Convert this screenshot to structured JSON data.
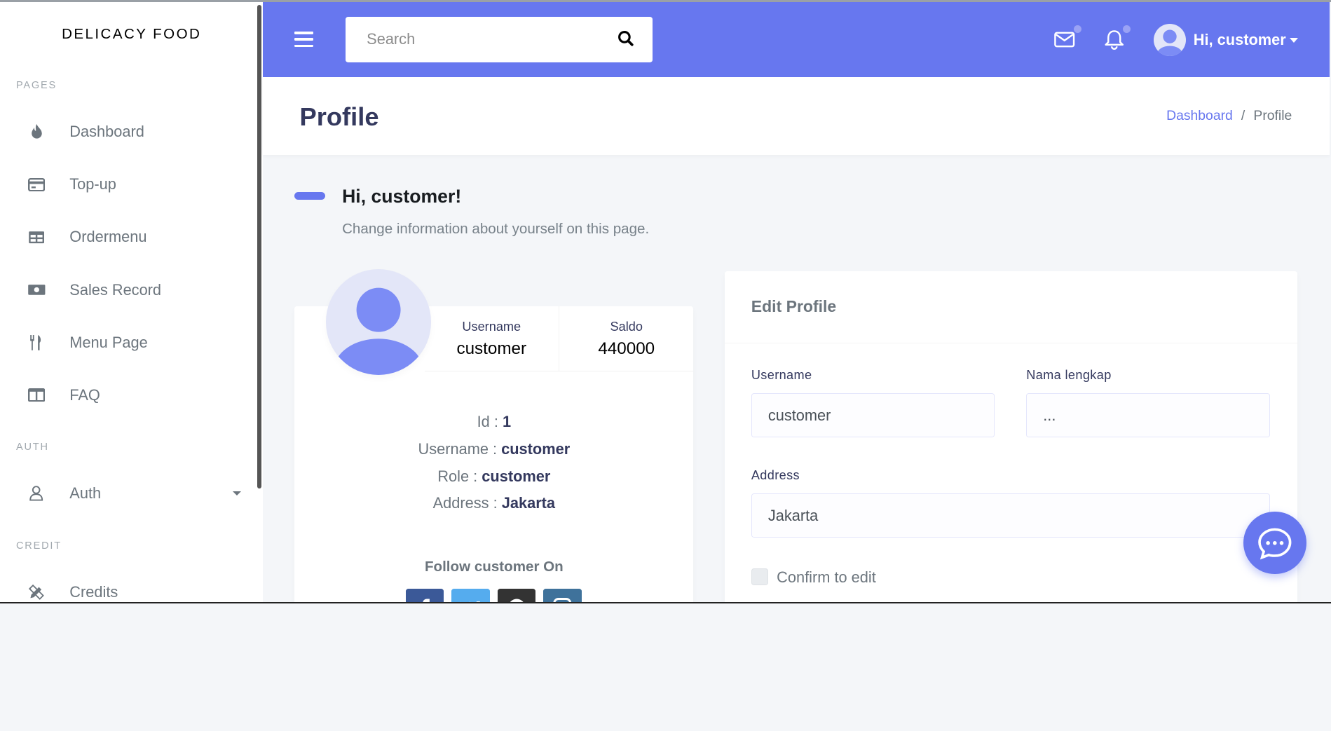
{
  "sidebar": {
    "brand": "DELICACY FOOD",
    "headers": {
      "pages": "PAGES",
      "auth": "AUTH",
      "credit": "CREDIT"
    },
    "items": [
      {
        "label": "Dashboard",
        "icon": "fire-icon"
      },
      {
        "label": "Top-up",
        "icon": "credit-card-icon"
      },
      {
        "label": "Ordermenu",
        "icon": "table-icon"
      },
      {
        "label": "Sales Record",
        "icon": "money-bill-icon"
      },
      {
        "label": "Menu Page",
        "icon": "utensils-icon"
      },
      {
        "label": "FAQ",
        "icon": "columns-icon"
      },
      {
        "label": "Auth",
        "icon": "user-icon"
      },
      {
        "label": "Credits",
        "icon": "pencil-ruler-icon"
      }
    ]
  },
  "navbar": {
    "search_placeholder": "Search",
    "user_greeting": "Hi, customer",
    "accent": "#6777ef"
  },
  "header": {
    "title": "Profile",
    "breadcrumb": [
      "Dashboard",
      "Profile"
    ]
  },
  "section": {
    "title": "Hi, customer!",
    "lead": "Change information about yourself on this page."
  },
  "profile_widget": {
    "items": [
      {
        "label": "Username",
        "value": "customer"
      },
      {
        "label": "Saldo",
        "value": "440000"
      }
    ],
    "info": [
      {
        "key": "Id :",
        "value": "1"
      },
      {
        "key": "Username :",
        "value": "customer"
      },
      {
        "key": "Role :",
        "value": "customer"
      },
      {
        "key": "Address :",
        "value": "Jakarta"
      }
    ],
    "follow_title": "Follow customer On",
    "social": [
      {
        "icon": "facebook-icon",
        "color": "#3b5998"
      },
      {
        "icon": "twitter-icon",
        "color": "#55acee"
      },
      {
        "icon": "github-icon",
        "color": "#333333"
      },
      {
        "icon": "instagram-icon",
        "color": "#3f729b"
      }
    ]
  },
  "edit_profile": {
    "title": "Edit Profile",
    "fields": {
      "username": {
        "label": "Username",
        "value": "customer"
      },
      "fullname": {
        "label": "Nama lengkap",
        "value": "..."
      },
      "address": {
        "label": "Address",
        "value": "Jakarta"
      }
    },
    "confirm_label": "Confirm to edit"
  }
}
